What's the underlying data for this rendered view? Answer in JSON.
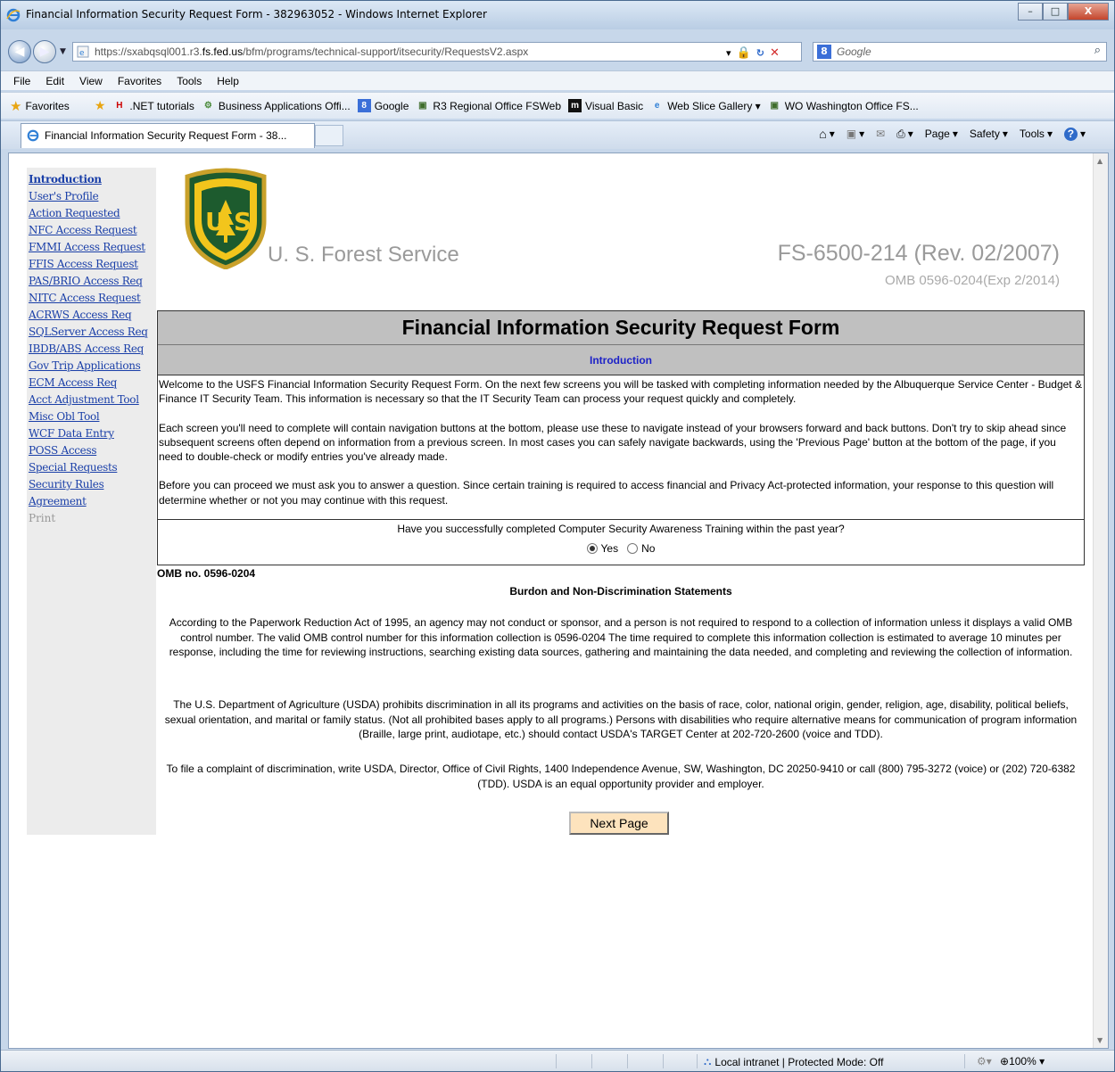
{
  "window": {
    "title": "Financial Information Security Request Form - 382963052 - Windows Internet Explorer",
    "minimize": "–",
    "maximize": "□",
    "close": "X"
  },
  "address_bar": {
    "url_prefix": "https://sxabqsql001.r3.",
    "url_domain": "fs.fed.us",
    "url_path": "/bfm/programs/technical-support/itsecurity/RequestsV2.aspx",
    "search_placeholder": "Google"
  },
  "menu": [
    "File",
    "Edit",
    "View",
    "Favorites",
    "Tools",
    "Help"
  ],
  "favorites_bar": {
    "favorites_label": "Favorites",
    "items": [
      {
        "label": ".NET tutorials",
        "icon": "H"
      },
      {
        "label": "Business Applications Offi...",
        "icon": "⚙"
      },
      {
        "label": "Google",
        "icon": "8"
      },
      {
        "label": "R3 Regional Office FSWeb",
        "icon": "▣"
      },
      {
        "label": "Visual Basic",
        "icon": "m"
      },
      {
        "label": "Web Slice Gallery ▾",
        "icon": "e"
      },
      {
        "label": "WO Washington Office FS...",
        "icon": "▣"
      }
    ]
  },
  "tab": {
    "label": "Financial Information Security Request Form - 38..."
  },
  "command_bar": [
    "Page",
    "Safety",
    "Tools"
  ],
  "nav": {
    "items": [
      "Introduction",
      "User's Profile",
      "Action Requested",
      "NFC Access Request",
      "FMMI Access Request",
      "FFIS Access Request",
      "PAS/BRIO Access Req",
      "NITC Access Request",
      "ACRWS Access Req",
      "SQLServer Access Req",
      "IBDB/ABS Access Req",
      "Gov Trip Applications",
      "ECM Access Req",
      "Acct Adjustment Tool",
      "Misc Obl Tool",
      "WCF Data Entry",
      "POSS Access",
      "Special Requests",
      "Security Rules",
      "Agreement"
    ],
    "disabled_item": "Print"
  },
  "header": {
    "agency": "U. S. Forest Service",
    "form_number": "FS-6500-214 (Rev. 02/2007)",
    "omb_expiry": "OMB 0596-0204(Exp 2/2014)"
  },
  "form": {
    "title": "Financial Information Security Request Form",
    "subtitle": "Introduction",
    "paragraphs": [
      "Welcome to the USFS Financial Information Security Request Form. On the next few screens you will be tasked with completing information needed by the Albuquerque Service Center - Budget & Finance IT Security Team. This information is necessary so that the IT Security Team can process your request quickly and completely.",
      "Each screen you'll need to complete will contain navigation buttons at the bottom, please use these to navigate instead of your browsers forward and back buttons. Don't try to skip ahead since subsequent screens often depend on information from a previous screen. In most cases you can safely navigate backwards, using the 'Previous Page' button at the bottom of the page, if you need to double-check or modify entries you've already made.",
      "Before you can proceed we must ask you to answer a question. Since certain training is required to access financial and Privacy Act-protected information, your response to this question will determine whether or not you may continue with this request."
    ],
    "question": "Have you successfully completed Computer Security Awareness Training within the past year?",
    "answer_yes": "Yes",
    "answer_no": "No"
  },
  "statements": {
    "omb_number": "OMB no. 0596-0204",
    "title": "Burdon and Non-Discrimination Statements",
    "paragraphs": [
      "According to the Paperwork Reduction Act of 1995, an agency may not conduct or sponsor, and a person is not required to respond to a collection of information unless it displays a valid OMB control number. The valid OMB control number for this information collection is 0596-0204 The time required to complete this information collection is estimated to average 10 minutes per response, including the time for reviewing instructions, searching existing data sources, gathering and maintaining the data needed, and completing and reviewing the collection of information.",
      "The U.S. Department of Agriculture (USDA) prohibits discrimination in all its programs and activities on the basis of race, color, national origin, gender, religion, age, disability, political beliefs, sexual orientation, and marital or family status. (Not all prohibited bases apply to all programs.) Persons with disabilities who require alternative means for communication of program information (Braille, large print, audiotape, etc.) should contact USDA's TARGET Center at 202-720-2600 (voice and TDD).",
      "To file a complaint of discrimination, write USDA, Director, Office of Civil Rights, 1400 Independence Avenue, SW, Washington, DC 20250-9410 or call (800) 795-3272 (voice) or (202) 720-6382 (TDD). USDA is an equal opportunity provider and employer."
    ],
    "next_button": "Next Page"
  },
  "status_bar": {
    "zone": "Local intranet | Protected Mode: Off",
    "zoom": "100%"
  },
  "colors": {
    "link": "#1a3fa8",
    "subtitle": "#1d22c7",
    "banner_gray": "#c0c0c0",
    "button_fill": "#fde3bd"
  }
}
